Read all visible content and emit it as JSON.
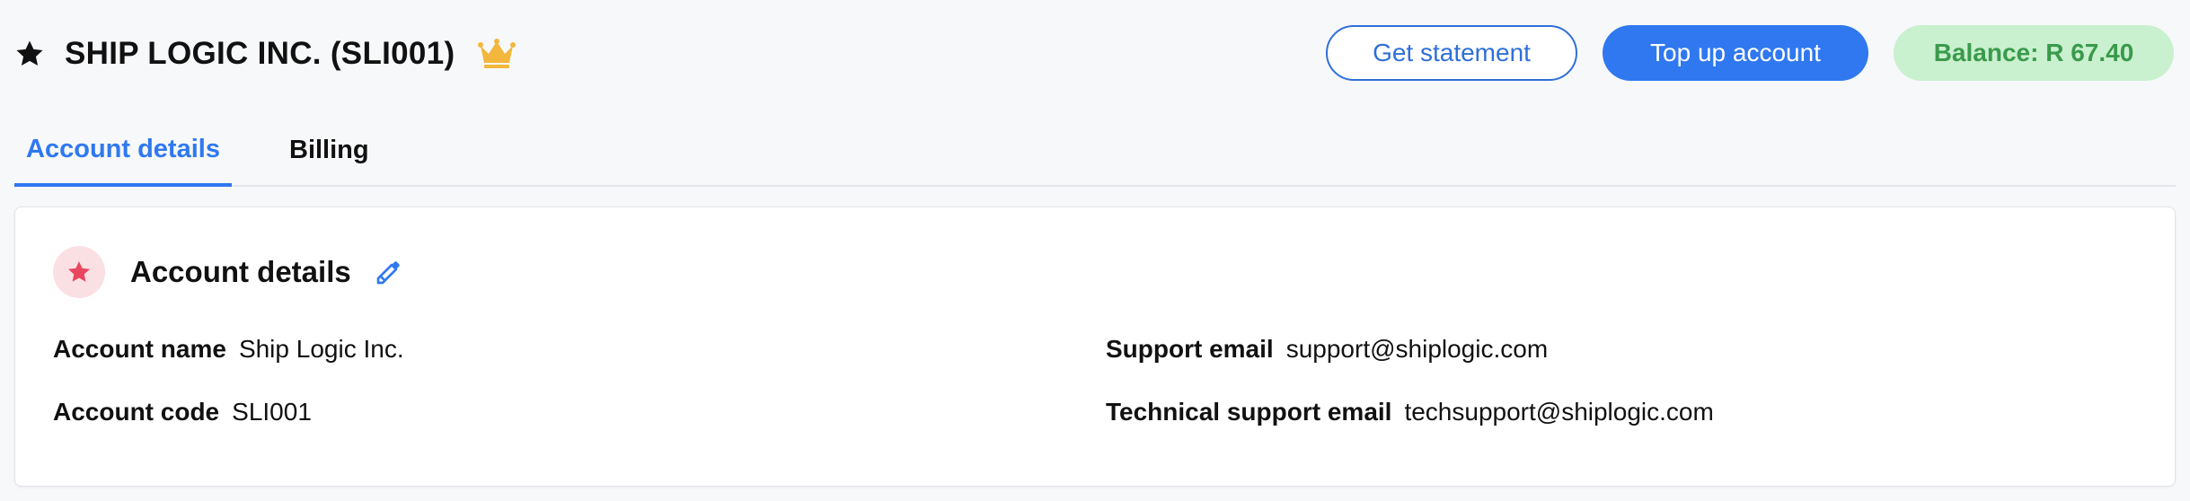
{
  "header": {
    "title": "SHIP LOGIC INC. (SLI001)",
    "star_icon": "star-icon",
    "crown_icon": "crown-icon",
    "get_statement_label": "Get statement",
    "top_up_label": "Top up account",
    "balance_text": "Balance: R 67.40",
    "colors": {
      "primary": "#2f78f0",
      "balance_bg": "#c9f0cf",
      "balance_text": "#3a9a4b",
      "crown": "#f2b73c"
    }
  },
  "tabs": [
    {
      "label": "Account details",
      "active": true
    },
    {
      "label": "Billing",
      "active": false
    }
  ],
  "card": {
    "title": "Account details",
    "icon": "star-circle-icon",
    "edit_icon": "pencil-icon",
    "fields": {
      "account_name": {
        "label": "Account name",
        "value": "Ship Logic Inc."
      },
      "account_code": {
        "label": "Account code",
        "value": "SLI001"
      },
      "support_email": {
        "label": "Support email",
        "value": "support@shiplogic.com"
      },
      "technical_support_email": {
        "label": "Technical support email",
        "value": "techsupport@shiplogic.com"
      }
    }
  }
}
